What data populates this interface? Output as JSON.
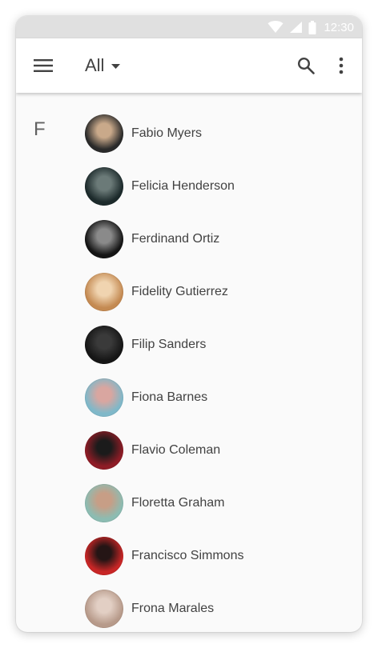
{
  "status_bar": {
    "time": "12:30",
    "icons": [
      "wifi-icon",
      "cellular-signal-icon",
      "battery-icon"
    ]
  },
  "app_bar": {
    "menu_icon": "menu-icon",
    "filter_label": "All",
    "dropdown_icon": "caret-down-icon",
    "search_icon": "search-icon",
    "more_icon": "more-vert-icon"
  },
  "contacts": {
    "section_letter": "F",
    "items": [
      {
        "name": "Fabio Myers",
        "avatar_colors": [
          "#2a2a2a",
          "#c9a98a"
        ]
      },
      {
        "name": "Felicia Henderson",
        "avatar_colors": [
          "#1c2a2b",
          "#6b7a78"
        ]
      },
      {
        "name": "Ferdinand Ortiz",
        "avatar_colors": [
          "#151515",
          "#8a8a8a"
        ]
      },
      {
        "name": "Fidelity Gutierrez",
        "avatar_colors": [
          "#c48a52",
          "#f0d4b0"
        ]
      },
      {
        "name": "Filip Sanders",
        "avatar_colors": [
          "#161616",
          "#3a3a3a"
        ]
      },
      {
        "name": "Fiona Barnes",
        "avatar_colors": [
          "#7fb8c9",
          "#d9a6a0"
        ]
      },
      {
        "name": "Flavio Coleman",
        "avatar_colors": [
          "#8e1c26",
          "#1b1b1b"
        ]
      },
      {
        "name": "Floretta Graham",
        "avatar_colors": [
          "#8cbcb2",
          "#c79e86"
        ]
      },
      {
        "name": "Francisco Simmons",
        "avatar_colors": [
          "#c82626",
          "#251515"
        ]
      },
      {
        "name": "Frona Marales",
        "avatar_colors": [
          "#b79a8a",
          "#e2cfc4"
        ]
      }
    ]
  },
  "colors": {
    "status_bar_bg": "#e0e0e0",
    "app_bar_bg": "#ffffff",
    "list_bg": "#fafafa",
    "primary_text": "#424242",
    "icon_color": "#424242"
  }
}
